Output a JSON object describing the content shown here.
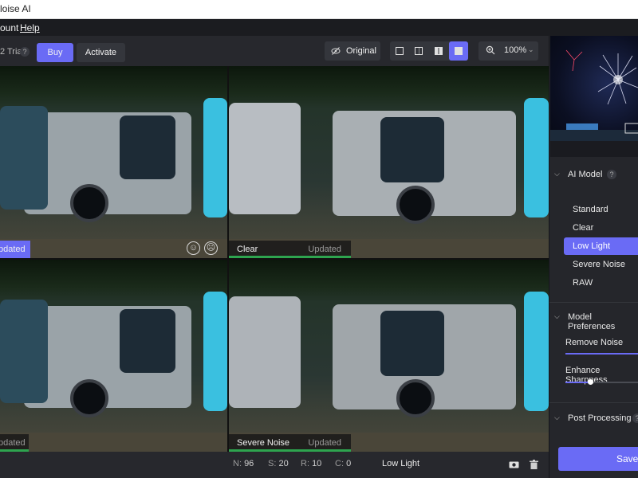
{
  "window": {
    "title": "loise AI"
  },
  "menu": {
    "items": [
      {
        "label": "ount"
      },
      {
        "label": "Help"
      }
    ]
  },
  "toolbar": {
    "trial": "2 Trial",
    "help": "?",
    "buy": "Buy",
    "activate": "Activate",
    "original": "Original",
    "zoom": "100%",
    "zoom_chevron": "⌄"
  },
  "panes": [
    {
      "label": "",
      "status": "pdated"
    },
    {
      "label": "Clear",
      "status": "Updated"
    },
    {
      "label": "",
      "status": "pdated"
    },
    {
      "label": "Severe Noise",
      "status": "Updated"
    }
  ],
  "status": {
    "n_key": "N:",
    "n_val": "96",
    "s_key": "S:",
    "s_val": "20",
    "r_key": "R:",
    "r_val": "10",
    "c_key": "C:",
    "c_val": "0",
    "model": "Low Light"
  },
  "panel": {
    "ai_model": {
      "title": "AI Model",
      "help": "?",
      "items": [
        "Standard",
        "Clear",
        "Low Light",
        "Severe Noise",
        "RAW"
      ],
      "selected": "Low Light"
    },
    "preferences": {
      "title": "Model Preferences",
      "remove_noise": "Remove Noise",
      "enhance_sharpness": "Enhance Sharpness"
    },
    "post": {
      "title": "Post Processing",
      "help": "?"
    },
    "save": "Save"
  },
  "colors": {
    "accent": "#6a6bf5",
    "progress": "#2ea44f",
    "panel_bg": "#25262b"
  }
}
